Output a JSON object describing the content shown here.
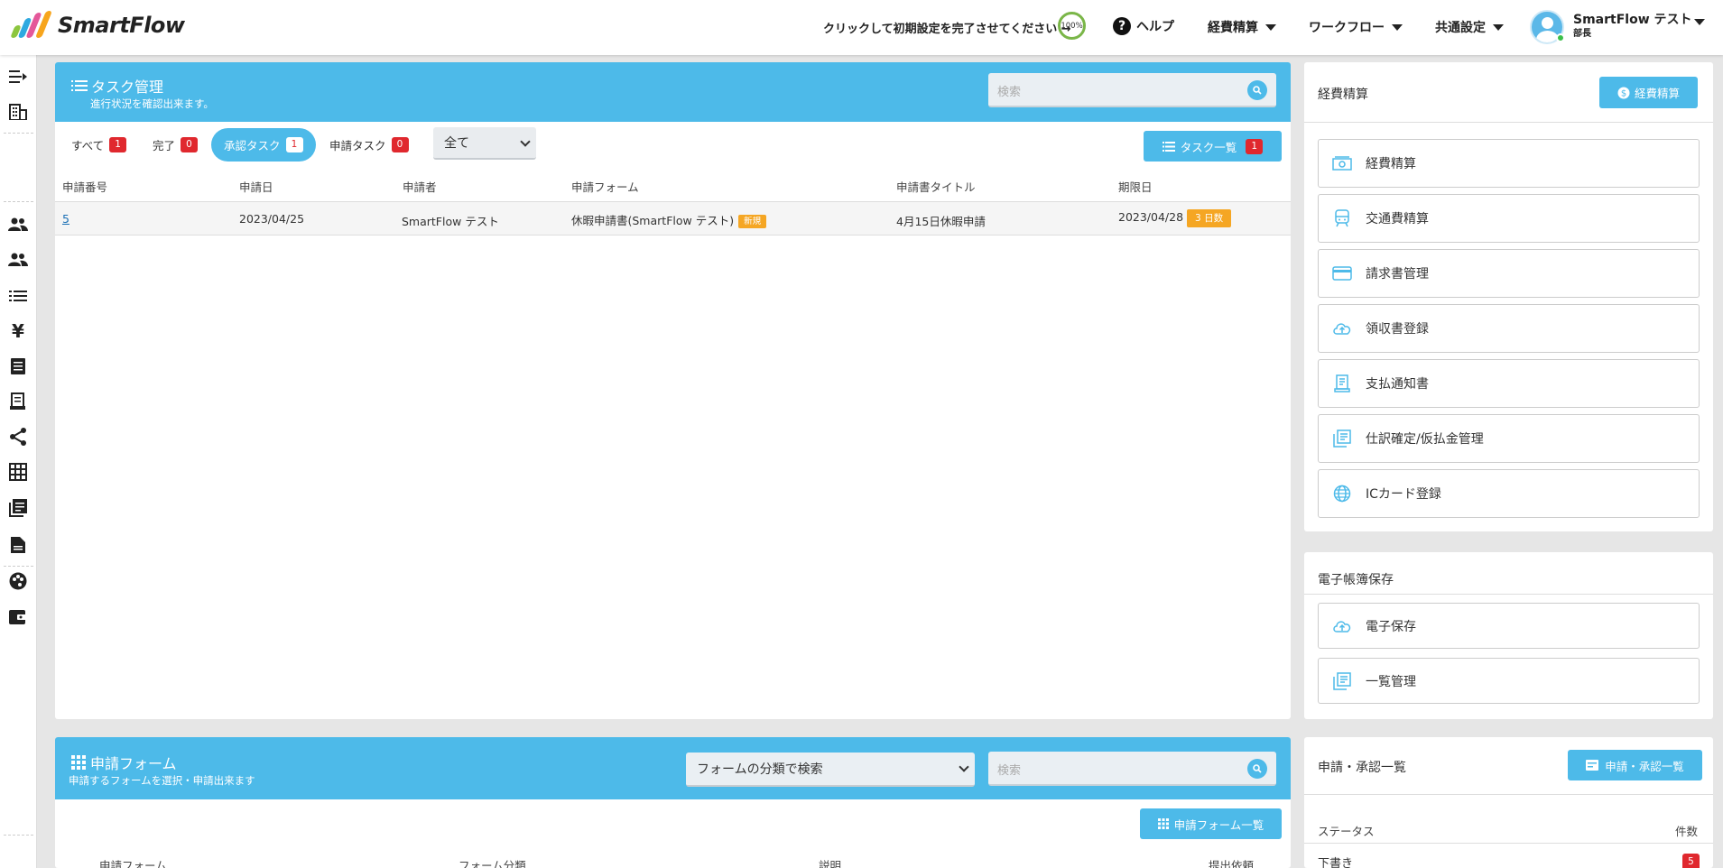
{
  "header": {
    "logo_text": "SmartFlow",
    "setup_text": "クリックして初期設定を完了させてください →",
    "progress": "100%",
    "help": "ヘルプ",
    "menus": [
      "経費精算",
      "ワークフロー",
      "共通設定"
    ],
    "user_name": "SmartFlow テスト",
    "user_role": "部長"
  },
  "task_panel": {
    "title": "タスク管理",
    "subtitle": "進行状況を確認出来ます。",
    "search_placeholder": "検索",
    "tabs": [
      {
        "label": "すべて",
        "count": "1"
      },
      {
        "label": "完了",
        "count": "0"
      },
      {
        "label": "承認タスク",
        "count": "1"
      },
      {
        "label": "申請タスク",
        "count": "0"
      }
    ],
    "filter_value": "全て",
    "list_button": "タスク一覧",
    "list_count": "1",
    "columns": [
      "申請番号",
      "申請日",
      "申請者",
      "申請フォーム",
      "申請書タイトル",
      "期限日"
    ],
    "rows": [
      {
        "number": "5",
        "date": "2023/04/25",
        "applicant": "SmartFlow テスト",
        "form": "休暇申請書(SmartFlow テスト)",
        "form_tag": "新規",
        "title": "4月15日休暇申請",
        "deadline": "2023/04/28",
        "deadline_tag": "3 日数"
      }
    ]
  },
  "expense_panel": {
    "title": "経費精算",
    "button": "経費精算",
    "items": [
      "経費精算",
      "交通費精算",
      "請求書管理",
      "領収書登録",
      "支払通知書",
      "仕訳確定/仮払金管理",
      "ICカード登録"
    ]
  },
  "ebook_panel": {
    "title": "電子帳簿保存",
    "items": [
      "電子保存",
      "一覧管理"
    ]
  },
  "approval_panel": {
    "title": "申請・承認一覧",
    "button": "申請・承認一覧",
    "col_status": "ステータス",
    "col_count": "件数",
    "first_status": "下書き",
    "first_count": "5"
  },
  "form_panel": {
    "title": "申請フォーム",
    "subtitle": "申請するフォームを選択・申請出来ます",
    "category_select": "フォームの分類で検索",
    "search_placeholder": "検索",
    "list_button": "申請フォーム一覧",
    "columns": [
      "申請フォーム",
      "フォーム分類",
      "説明",
      "提出依頼"
    ]
  },
  "colors": {
    "accent": "#4dbae9",
    "badge": "#e0282e",
    "tag": "#f5a623"
  }
}
